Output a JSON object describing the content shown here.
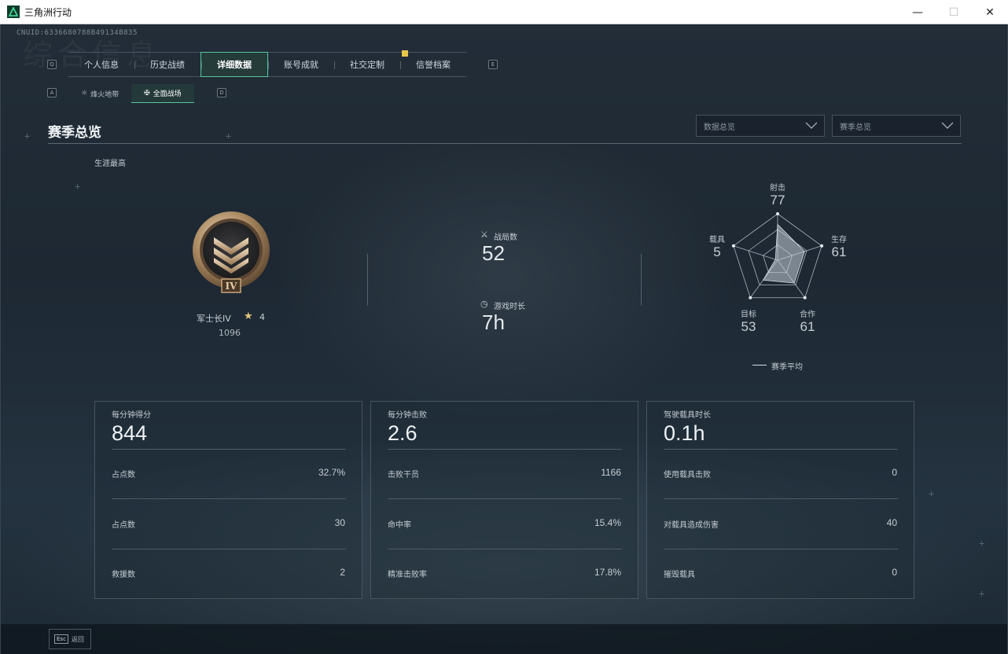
{
  "window": {
    "title": "三角洲行动",
    "controls": {
      "minimize": "—",
      "maximize": "☐",
      "close": "✕"
    }
  },
  "header": {
    "uid": "CNUID:6336680788B49134B835",
    "ghost_title": "综合信息"
  },
  "keyhints": {
    "prev_tab": "Q",
    "next_tab": "E",
    "prev_sub": "A",
    "next_sub": "D"
  },
  "tabs": [
    {
      "label": "个人信息"
    },
    {
      "label": "历史战绩"
    },
    {
      "label": "详细数据",
      "active": true
    },
    {
      "label": "账号成就"
    },
    {
      "label": "社交定制"
    },
    {
      "label": "信誉档案"
    }
  ],
  "subtabs": [
    {
      "label": "烽火地带"
    },
    {
      "label": "全面战场",
      "active": true
    }
  ],
  "section": {
    "title": "赛季总览",
    "dropdown_data": "数据总览",
    "dropdown_season": "赛季总览",
    "career_label": "生涯最高"
  },
  "rank": {
    "name": "军士长IV",
    "stars": "4",
    "points": "1096",
    "numeral": "IV"
  },
  "summary": {
    "matches_label": "战局数",
    "matches_value": "52",
    "playtime_label": "游戏时长",
    "playtime_value": "7h"
  },
  "radar": {
    "axes": [
      {
        "label": "射击",
        "value": "77",
        "score": 77
      },
      {
        "label": "生存",
        "value": "61",
        "score": 61
      },
      {
        "label": "合作",
        "value": "61",
        "score": 61
      },
      {
        "label": "目标",
        "value": "53",
        "score": 53
      },
      {
        "label": "载具",
        "value": "5",
        "score": 5
      }
    ],
    "legend": "赛季平均"
  },
  "cards": [
    {
      "title": "每分钟得分",
      "value": "844",
      "rows": [
        {
          "label": "占点数",
          "value": "32.7%"
        },
        {
          "label": "占点数",
          "value": "30"
        },
        {
          "label": "救援数",
          "value": "2"
        }
      ]
    },
    {
      "title": "每分钟击败",
      "value": "2.6",
      "rows": [
        {
          "label": "击败干员",
          "value": "1166"
        },
        {
          "label": "命中率",
          "value": "15.4%"
        },
        {
          "label": "精准击败率",
          "value": "17.8%"
        }
      ]
    },
    {
      "title": "驾驶载具时长",
      "value": "0.1h",
      "rows": [
        {
          "label": "使用载具击败",
          "value": "0"
        },
        {
          "label": "对载具造成伤害",
          "value": "40"
        },
        {
          "label": "摧毁载具",
          "value": "0"
        }
      ]
    }
  ],
  "footer": {
    "esc_key": "Esc",
    "esc_label": "返回"
  },
  "colors": {
    "accent": "#56c79a",
    "badge": "#e8c64a",
    "background": "#1b2530"
  }
}
